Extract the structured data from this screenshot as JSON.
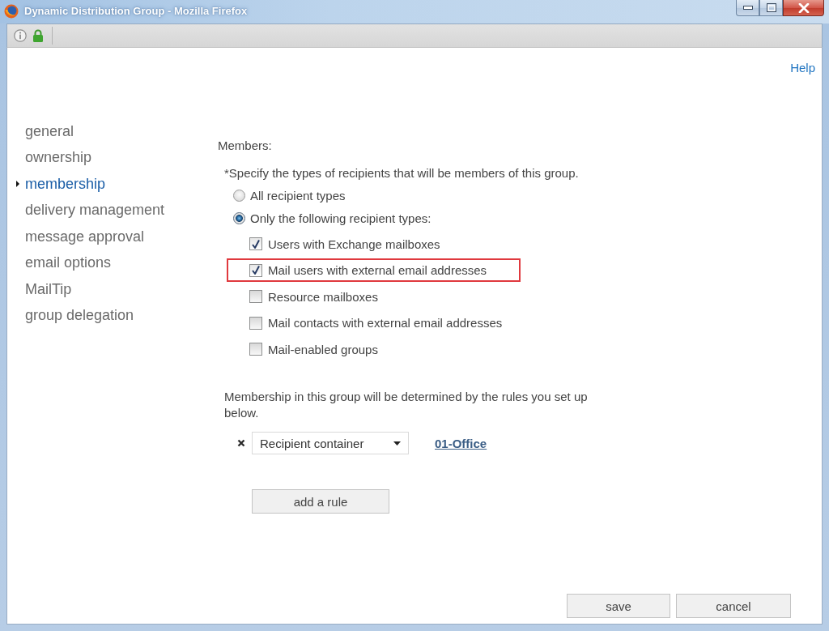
{
  "window": {
    "title": "Dynamic Distribution Group - Mozilla Firefox"
  },
  "help_link": "Help",
  "sidebar": {
    "items": [
      {
        "label": "general",
        "selected": false
      },
      {
        "label": "ownership",
        "selected": false
      },
      {
        "label": "membership",
        "selected": true
      },
      {
        "label": "delivery management",
        "selected": false
      },
      {
        "label": "message approval",
        "selected": false
      },
      {
        "label": "email options",
        "selected": false
      },
      {
        "label": "MailTip",
        "selected": false
      },
      {
        "label": "group delegation",
        "selected": false
      }
    ]
  },
  "members": {
    "heading": "Members:",
    "instruction": "*Specify the types of recipients that will be members of this group.",
    "scope_options": [
      {
        "label": "All recipient types",
        "selected": false
      },
      {
        "label": "Only the following recipient types:",
        "selected": true
      }
    ],
    "recipient_types": [
      {
        "label": "Users with Exchange mailboxes",
        "checked": true,
        "highlighted": false
      },
      {
        "label": "Mail users with external email addresses",
        "checked": true,
        "highlighted": true
      },
      {
        "label": "Resource mailboxes",
        "checked": false,
        "highlighted": false
      },
      {
        "label": "Mail contacts with external email addresses",
        "checked": false,
        "highlighted": false
      },
      {
        "label": "Mail-enabled groups",
        "checked": false,
        "highlighted": false
      }
    ]
  },
  "rules": {
    "description": "Membership in this group will be determined by the rules you set up below.",
    "items": [
      {
        "property": "Recipient container",
        "value": "01-Office"
      }
    ],
    "add_button": "add a rule"
  },
  "buttons": [
    "save",
    "cancel"
  ]
}
